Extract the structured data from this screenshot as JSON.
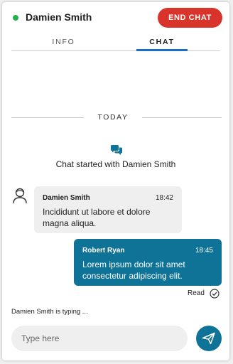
{
  "header": {
    "contact_name": "Damien Smith",
    "status": "online",
    "status_color": "#22b14c",
    "end_chat_label": "END CHAT",
    "end_chat_color": "#d9342b"
  },
  "tabs": [
    {
      "label": "INFO",
      "active": false
    },
    {
      "label": "CHAT",
      "active": true
    }
  ],
  "accent_color": "#1a6ec8",
  "divider_label": "TODAY",
  "system_message": {
    "icon": "chat-bubbles-icon",
    "text": "Chat started with Damien Smith"
  },
  "messages": [
    {
      "direction": "incoming",
      "sender": "Damien Smith",
      "time": "18:42",
      "text": "Incididunt ut labore et dolore magna aliqua.",
      "avatar_icon": "user-avatar-icon"
    },
    {
      "direction": "outgoing",
      "sender": "Robert Ryan",
      "time": "18:45",
      "text": "Lorem ipsum dolor sit amet consectetur adipiscing elit.",
      "bubble_color": "#0e7396"
    }
  ],
  "read_receipt": {
    "label": "Read",
    "icon": "check-circle-icon"
  },
  "typing_indicator": "Damien Smith is typing ...",
  "composer": {
    "placeholder": "Type here",
    "value": "",
    "send_icon": "send-icon"
  }
}
